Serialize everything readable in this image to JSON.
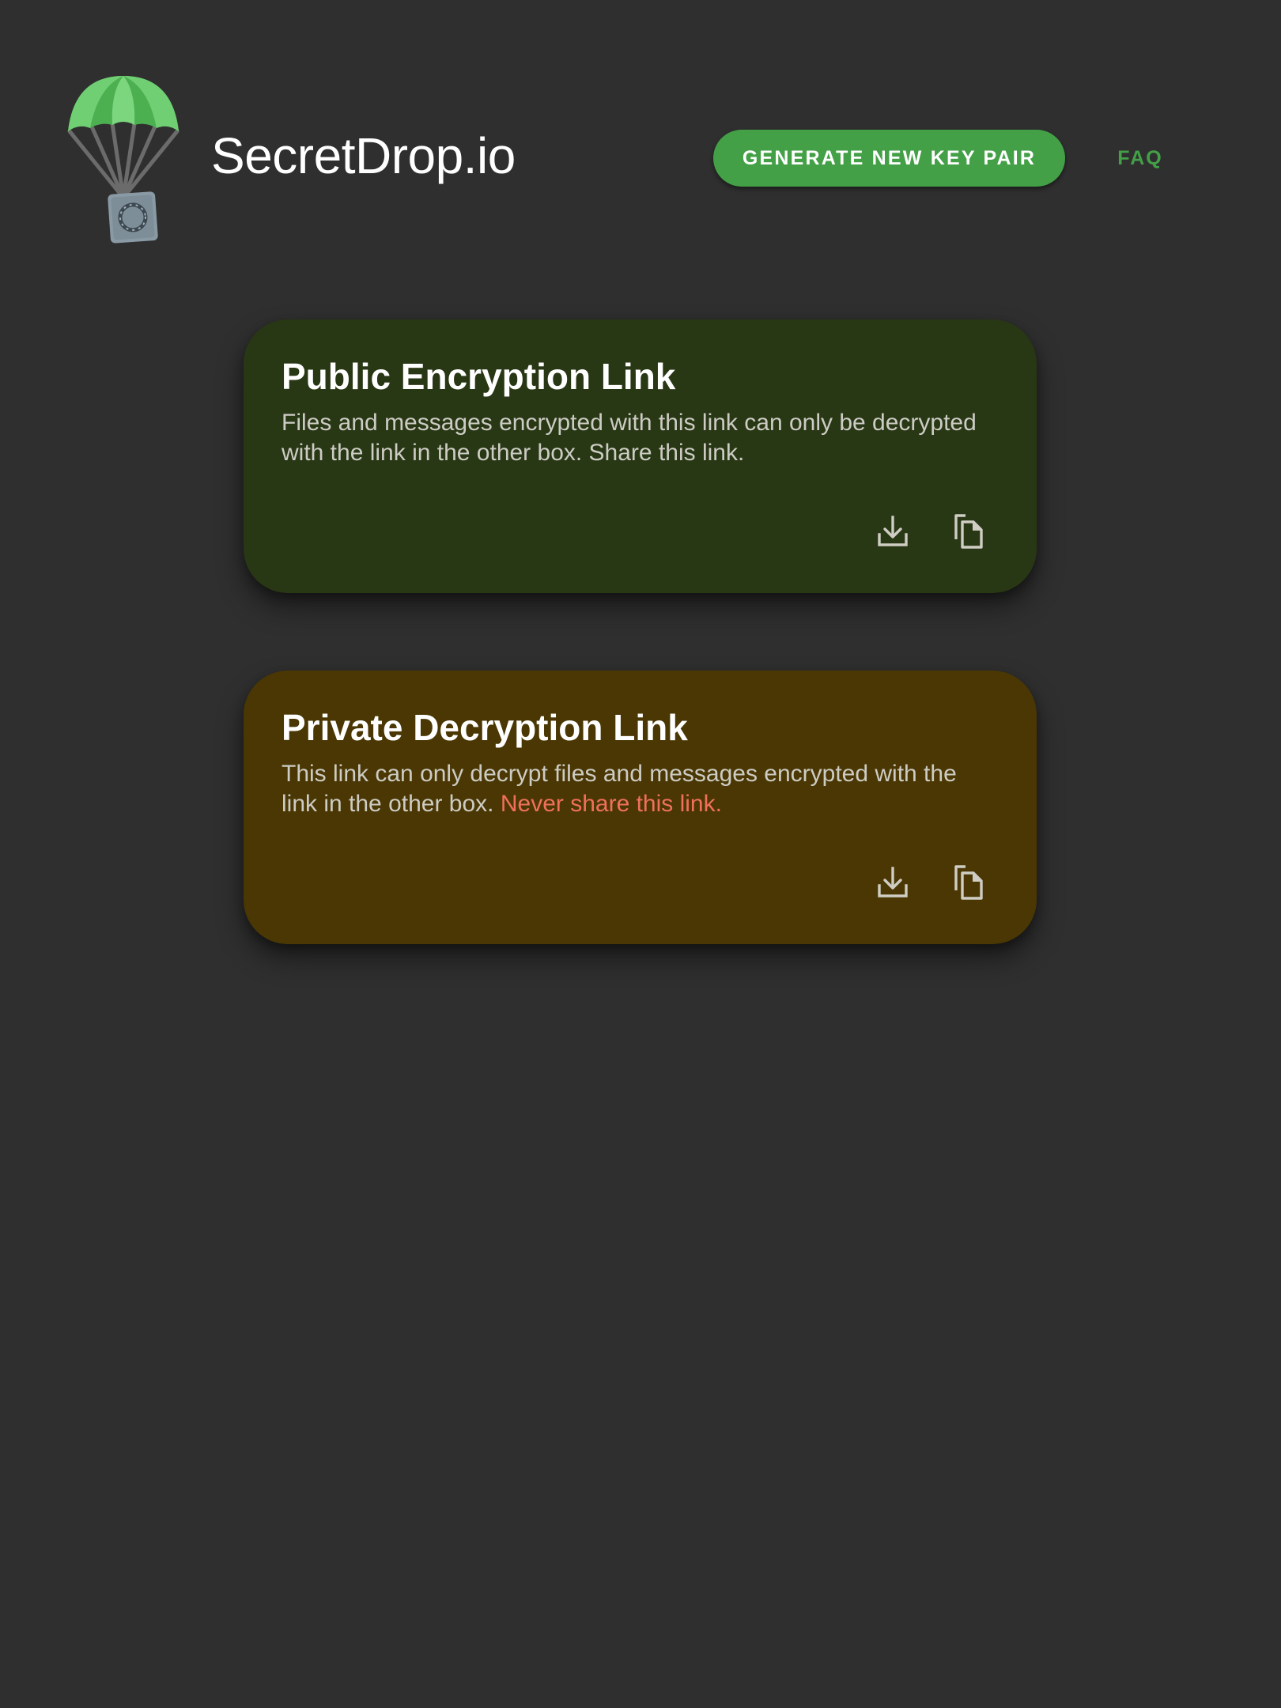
{
  "header": {
    "brand_title": "SecretDrop.io",
    "logo_icon": "parachute-safe-icon",
    "generate_button_label": "GENERATE NEW KEY PAIR",
    "faq_label": "FAQ"
  },
  "cards": {
    "public": {
      "title": "Public Encryption Link",
      "description": "Files and messages encrypted with this link can only be decrypted with the link in the other box. Share this link.",
      "actions": [
        "download-icon",
        "copy-icon"
      ]
    },
    "private": {
      "title": "Private Decryption Link",
      "description": "This link can only decrypt files and messages encrypted with the link in the other box.",
      "warning": "Never share this link.",
      "actions": [
        "download-icon",
        "copy-icon"
      ]
    }
  },
  "colors": {
    "background": "#2f2f2f",
    "accent": "#43a047",
    "public_card": "#283714",
    "private_card": "#4a3703",
    "warning": "#f0705c",
    "body_text": "#cdccc4"
  }
}
